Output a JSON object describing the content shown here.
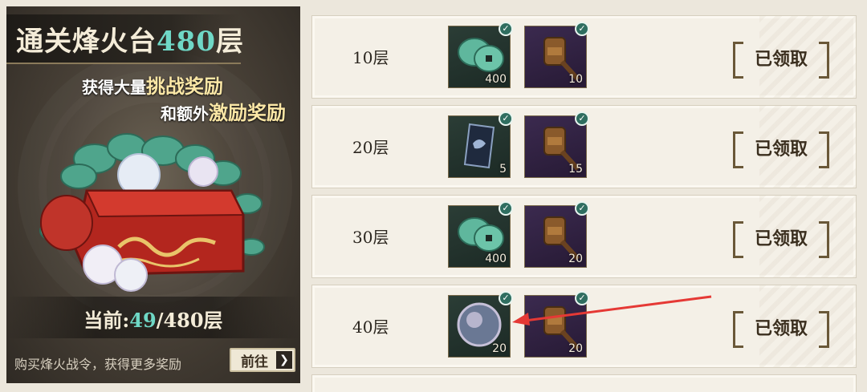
{
  "promo": {
    "title_prefix": "通关烽火台",
    "title_floor": "480",
    "title_suffix": "层",
    "line1_prefix": "获得大量",
    "line1_highlight": "挑战奖励",
    "line2_prefix": "和额外",
    "line2_highlight": "激励奖励",
    "progress_prefix": "当前:",
    "progress_current": "49",
    "progress_total": "/480层",
    "buy_text": "购买烽火战令，获得更多奖励",
    "goto_label": "前往",
    "goto_arrow": "❯"
  },
  "rows": [
    {
      "label": "10层",
      "items": [
        {
          "icon": "jade-coin-icon",
          "count": "400",
          "bg": "green"
        },
        {
          "icon": "gavel-icon",
          "count": "10",
          "bg": "purple"
        }
      ],
      "claim_label": "已领取"
    },
    {
      "label": "20层",
      "items": [
        {
          "icon": "scroll-card-icon",
          "count": "5",
          "bg": "green"
        },
        {
          "icon": "gavel-icon",
          "count": "15",
          "bg": "purple"
        }
      ],
      "claim_label": "已领取"
    },
    {
      "label": "30层",
      "items": [
        {
          "icon": "jade-coin-icon",
          "count": "400",
          "bg": "green"
        },
        {
          "icon": "gavel-icon",
          "count": "20",
          "bg": "purple"
        }
      ],
      "claim_label": "已领取"
    },
    {
      "label": "40层",
      "items": [
        {
          "icon": "pearl-orb-icon",
          "count": "20",
          "bg": "green"
        },
        {
          "icon": "gavel-icon",
          "count": "20",
          "bg": "purple"
        }
      ],
      "claim_label": "已领取"
    }
  ],
  "colors": {
    "accent_teal": "#6fd8c6",
    "claimed_check": "#2f6e60",
    "annotation_arrow": "#e53935"
  }
}
